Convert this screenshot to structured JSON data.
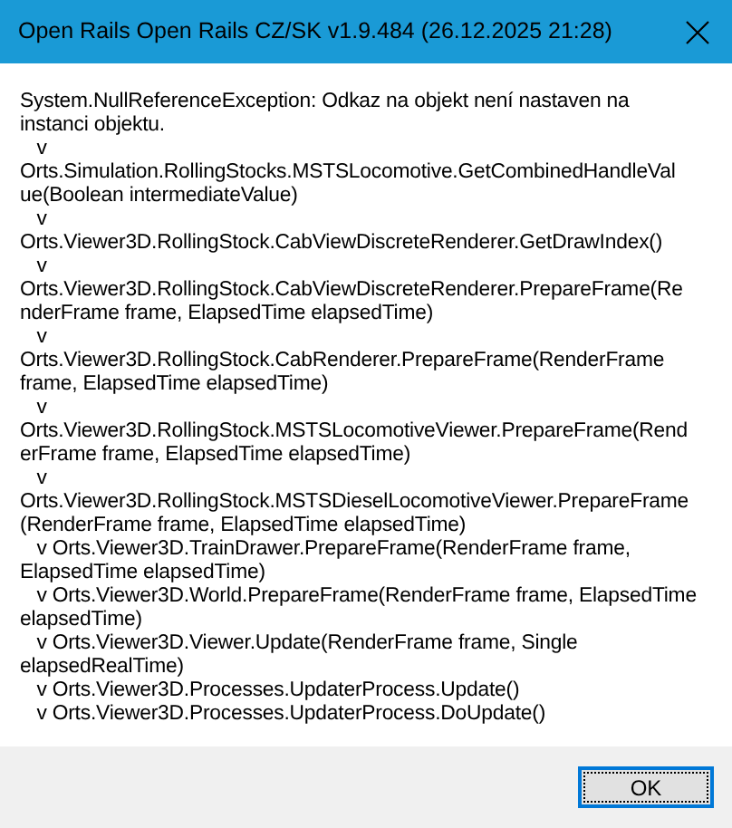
{
  "window": {
    "title": "Open Rails Open Rails CZ/SK v1.9.484 (26.12.2025 21:28)"
  },
  "message": "System.NullReferenceException: Odkaz na objekt není nastaven na\ninstanci objektu.\n   v\nOrts.Simulation.RollingStocks.MSTSLocomotive.GetCombinedHandleVal\nue(Boolean intermediateValue)\n   v\nOrts.Viewer3D.RollingStock.CabViewDiscreteRenderer.GetDrawIndex()\n   v\nOrts.Viewer3D.RollingStock.CabViewDiscreteRenderer.PrepareFrame(Re\nnderFrame frame, ElapsedTime elapsedTime)\n   v\nOrts.Viewer3D.RollingStock.CabRenderer.PrepareFrame(RenderFrame\nframe, ElapsedTime elapsedTime)\n   v\nOrts.Viewer3D.RollingStock.MSTSLocomotiveViewer.PrepareFrame(Rend\nerFrame frame, ElapsedTime elapsedTime)\n   v\nOrts.Viewer3D.RollingStock.MSTSDieselLocomotiveViewer.PrepareFrame\n(RenderFrame frame, ElapsedTime elapsedTime)\n   v Orts.Viewer3D.TrainDrawer.PrepareFrame(RenderFrame frame,\nElapsedTime elapsedTime)\n   v Orts.Viewer3D.World.PrepareFrame(RenderFrame frame, ElapsedTime\nelapsedTime)\n   v Orts.Viewer3D.Viewer.Update(RenderFrame frame, Single\nelapsedRealTime)\n   v Orts.Viewer3D.Processes.UpdaterProcess.Update()\n   v Orts.Viewer3D.Processes.UpdaterProcess.DoUpdate()",
  "buttons": [
    {
      "label": "OK"
    }
  ]
}
